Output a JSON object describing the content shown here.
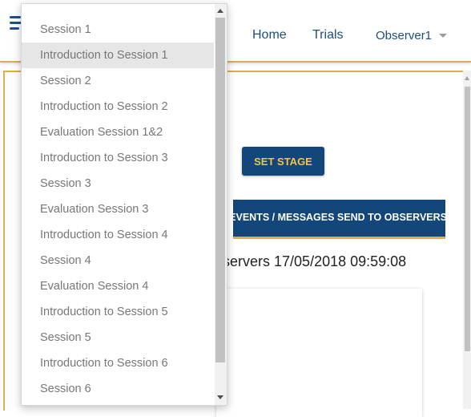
{
  "nav": {
    "home_label": "Home",
    "trials_label": "Trials",
    "user_label": "Observer1",
    "logo_icon": "hamburger-logo-icon"
  },
  "main": {
    "set_stage_label": "SET STAGE",
    "events_label": "EVENTS / MESSAGES SEND TO OBSERVERS",
    "observers_text": "bservers  17/05/2018 09:59:08"
  },
  "dropdown": {
    "selected_index": 1,
    "items": [
      "Session 1",
      "Introduction to Session 1",
      "Session 2",
      "Introduction to Session 2",
      "Evaluation Session 1&2",
      "Introduction to Session 3",
      "Session 3",
      "Evaluation Session 3",
      "Introduction to Session 4",
      "Session 4",
      "Evaluation Session 4",
      "Introduction to Session 5",
      "Session 5",
      "Introduction to Session 6",
      "Session 6"
    ]
  },
  "colors": {
    "primary": "#13467a",
    "accent": "#d9b04c",
    "button_text": "#f5c542"
  }
}
